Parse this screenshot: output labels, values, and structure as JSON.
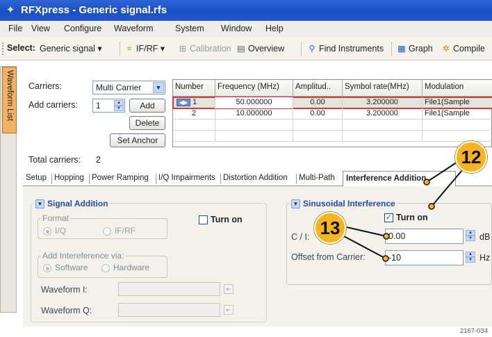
{
  "window": {
    "title": "RFXpress - Generic signal.rfs",
    "app_icon": "rfxpress-app-icon"
  },
  "menu": [
    "File",
    "View",
    "Configure",
    "Waveform",
    "System",
    "Window",
    "Help"
  ],
  "toolbar": {
    "select_label": "Select:",
    "select_value": "Generic signal",
    "ifrf": "IF/RF",
    "calibration": "Calibration",
    "overview": "Overview",
    "find_instruments": "Find Instruments",
    "graph": "Graph",
    "compile": "Compile"
  },
  "side_tab": {
    "label": "Waveform List"
  },
  "carriers": {
    "carriers_label": "Carriers:",
    "carriers_mode": "Multi Carrier",
    "add_label": "Add carriers:",
    "add_count": "1",
    "add_button": "Add",
    "delete_button": "Delete",
    "set_anchor_button": "Set Anchor",
    "total_label": "Total carriers:",
    "total_value": "2"
  },
  "grid": {
    "headers": [
      "Number",
      "Frequency (MHz)",
      "Amplitud..",
      "Symbol rate(MHz)",
      "Modulation"
    ],
    "rows": [
      {
        "number": "1",
        "frequency": "50.000000",
        "amplitude": "0.00",
        "symbol_rate": "3.200000",
        "modulation": "File1(Sample"
      },
      {
        "number": "2",
        "frequency": "10.000000",
        "amplitude": "0.00",
        "symbol_rate": "3.200000",
        "modulation": "File1(Sample"
      }
    ]
  },
  "tabs": [
    "Setup",
    "Hopping",
    "Power Ramping",
    "I/Q Impairments",
    "Distortion Addition",
    "Multi-Path",
    "Interference Addition"
  ],
  "active_tab": "Interference Addition",
  "signal_addition": {
    "title": "Signal Addition",
    "turn_on_label": "Turn on",
    "turn_on_checked": false,
    "format_label": "Format",
    "format_options": [
      "I/Q",
      "IF/RF"
    ],
    "format_selected": "I/Q",
    "add_via_label": "Add Intereference via:",
    "add_via_options": [
      "Software",
      "Hardware"
    ],
    "add_via_selected": "Software",
    "waveform_i_label": "Waveform I:",
    "waveform_q_label": "Waveform Q:"
  },
  "sinusoidal": {
    "title": "Sinusoidal Interference",
    "turn_on_label": "Turn on",
    "turn_on_checked": true,
    "ci_label": "C / I:",
    "ci_value": "0.00",
    "ci_unit": "dB",
    "offset_label": "Offset from Carrier:",
    "offset_value": "-10",
    "offset_unit": "Hz"
  },
  "callouts": [
    "12",
    "13"
  ],
  "figure_ref": "2167-034",
  "colors": {
    "callout": "#f6b420",
    "titlebar": "#2458c8",
    "highlight_row": "#d23a3a"
  }
}
